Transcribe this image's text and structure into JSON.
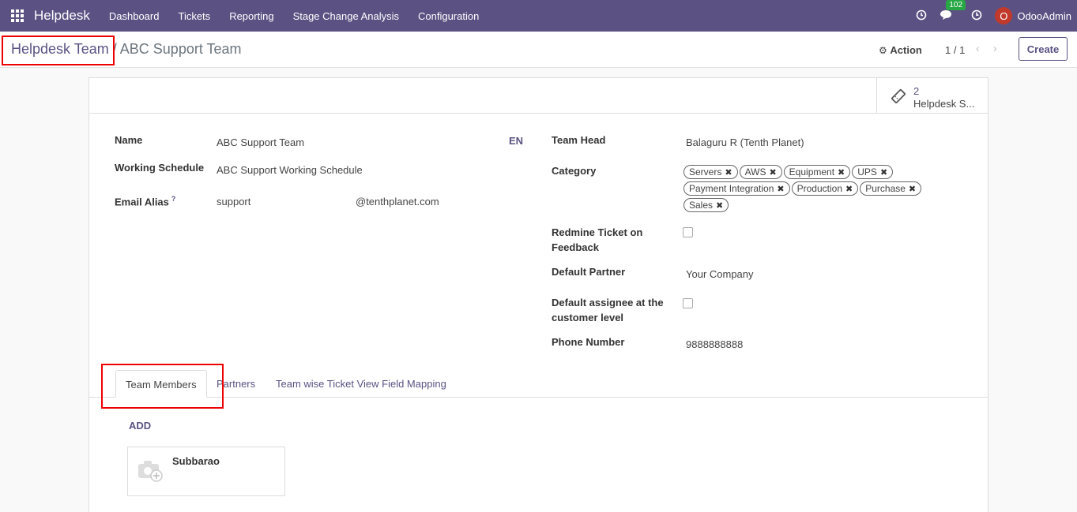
{
  "navbar": {
    "app_name": "Helpdesk",
    "menu": [
      "Dashboard",
      "Tickets",
      "Reporting",
      "Stage Change Analysis",
      "Configuration"
    ],
    "message_badge": "102",
    "avatar_letter": "O",
    "user_name": "OdooAdmin",
    "colors": {
      "bar": "#5b5283",
      "badge": "#28a745",
      "avatar": "#c0392b"
    }
  },
  "control_panel": {
    "breadcrumb_parent": "Helpdesk Team",
    "breadcrumb_sep": "/",
    "breadcrumb_current": "ABC Support Team",
    "action_label": "Action",
    "pager": "1 / 1",
    "create_label": "Create"
  },
  "smart_button": {
    "value": "2",
    "label": "Helpdesk S..."
  },
  "form": {
    "name_label": "Name",
    "name_value": "ABC Support Team",
    "lang": "EN",
    "schedule_label": "Working Schedule",
    "schedule_value": "ABC Support Working Schedule",
    "alias_label": "Email Alias",
    "alias_help": "?",
    "alias_value": "support",
    "alias_domain": "@tenthplanet.com",
    "team_head_label": "Team Head",
    "team_head_value": "Balaguru R (Tenth Planet)",
    "category_label": "Category",
    "categories": [
      "Servers",
      "AWS",
      "Equipment",
      "UPS",
      "Payment Integration",
      "Production",
      "Purchase",
      "Sales"
    ],
    "redmine_label": "Redmine Ticket on Feedback",
    "redmine_checked": false,
    "partner_label": "Default Partner",
    "partner_value": "Your Company",
    "assignee_label": "Default assignee at the customer level",
    "assignee_checked": false,
    "phone_label": "Phone Number",
    "phone_value": "9888888888"
  },
  "tabs": [
    "Team Members",
    "Partners",
    "Team wise Ticket View Field Mapping"
  ],
  "active_tab": "Team Members",
  "team_members": {
    "add_label": "ADD",
    "members": [
      {
        "name": "Subbarao"
      }
    ]
  }
}
